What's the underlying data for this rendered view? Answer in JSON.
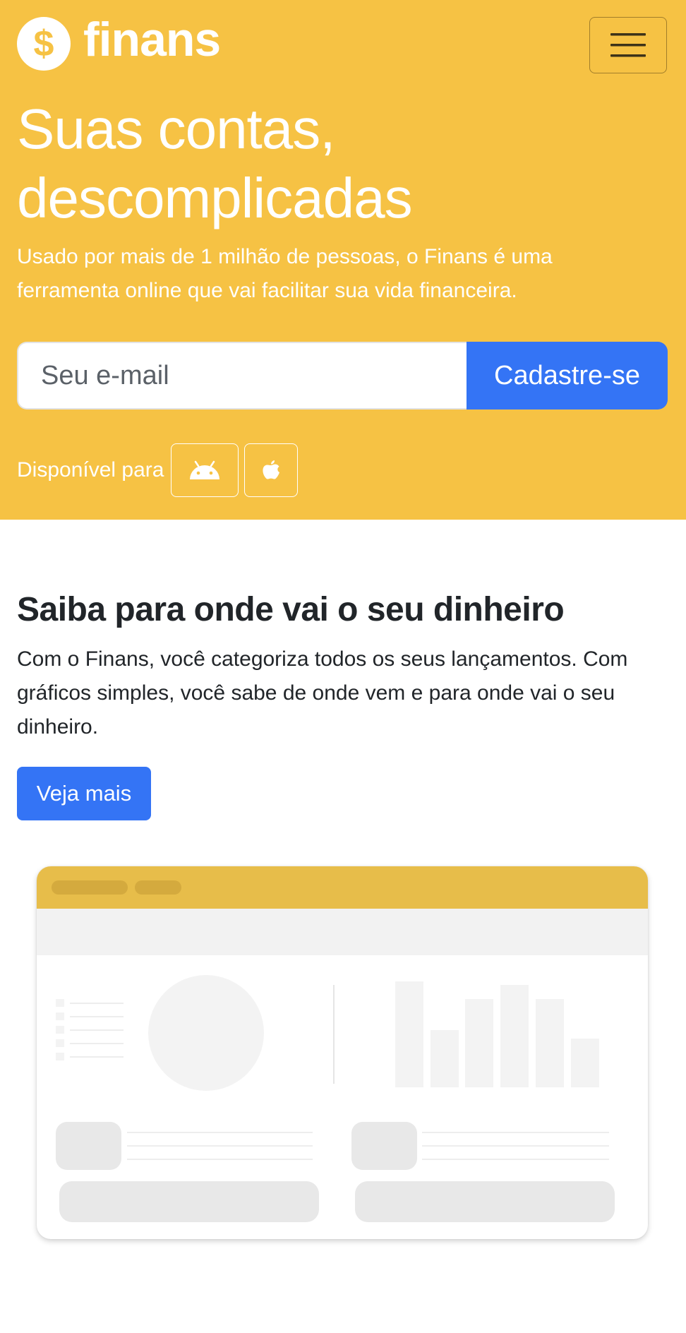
{
  "brand": {
    "name": "finans",
    "logo_icon": "dollar-coin-icon"
  },
  "nav": {
    "menu_icon": "hamburger-menu-icon"
  },
  "hero": {
    "title_line1": "Suas contas,",
    "title_line2": "descomplicadas",
    "subtitle": "Usado por mais de 1 milhão de pessoas, o Finans é uma ferramenta online que vai facilitar sua vida financeira.",
    "email_placeholder": "Seu e-mail",
    "signup_label": "Cadastre-se",
    "available_label": "Disponível para",
    "stores": [
      {
        "name": "android",
        "icon": "android-icon"
      },
      {
        "name": "apple",
        "icon": "apple-icon"
      }
    ]
  },
  "feature": {
    "title": "Saiba para onde vai o seu dinheiro",
    "text": "Com o Finans, você categoriza todos os seus lançamentos. Com gráficos simples, você sabe de onde vem e para onde vai o seu dinheiro.",
    "cta_label": "Veja mais"
  },
  "colors": {
    "hero_bg": "#f6c244",
    "primary": "#3474f5",
    "mockup_header": "#e7bd4a"
  }
}
